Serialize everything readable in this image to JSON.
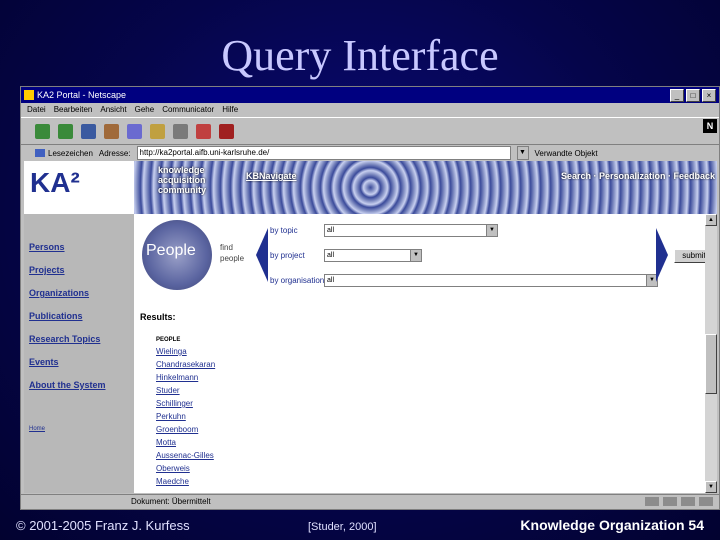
{
  "slide": {
    "title": "Query Interface",
    "footer_left": "© 2001-2005 Franz J. Kurfess",
    "footer_mid": "[Studer, 2000]",
    "footer_right": "Knowledge Organization  54"
  },
  "browser": {
    "window_title": "KA2 Portal - Netscape",
    "menu": [
      "Datei",
      "Bearbeiten",
      "Ansicht",
      "Gehe",
      "Communicator",
      "Hilfe"
    ],
    "bookmarks_label": "Lesezeichen",
    "address_label": "Adresse:",
    "url": "http://ka2portal.aifb.uni-karlsruhe.de/",
    "related_label": "Verwandte Objekt",
    "status_text": "Dokument: Übermittelt"
  },
  "page": {
    "logo": "KA²",
    "community_lines": [
      "knowledge",
      "acquisition",
      "community"
    ],
    "kbnavigate": "KBNavigate",
    "top_nav": "Search · Personalization · Feedback",
    "sidebar_links": [
      "Persons",
      "Projects",
      "Organizations",
      "Publications",
      "Research Topics",
      "Events",
      "About the System"
    ],
    "home_link": "Home",
    "people_label": "People",
    "find_people": [
      "find",
      "people"
    ],
    "filters": [
      {
        "label": "by topic",
        "value": "all"
      },
      {
        "label": "by project",
        "value": "all"
      },
      {
        "label": "by organisation",
        "value": "all"
      }
    ],
    "submit_label": "submit",
    "results_label": "Results:",
    "people_header": "PEOPLE",
    "people": [
      "Wielinga",
      "Chandrasekaran",
      "Hinkelmann",
      "Studer",
      "Schillinger",
      "Perkuhn",
      "Groenboom",
      "Motta",
      "Aussenac-Gilles",
      "Oberweis",
      "Maedche"
    ]
  }
}
